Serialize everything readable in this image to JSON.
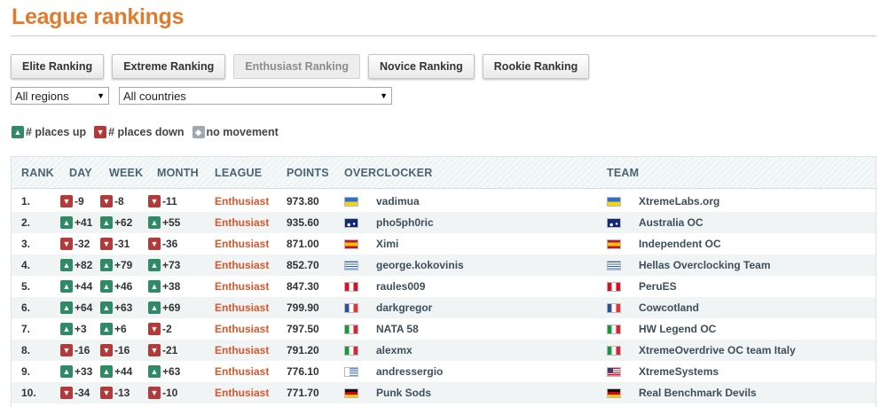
{
  "page": {
    "title": "League rankings"
  },
  "tabs": [
    {
      "label": "Elite Ranking",
      "active": false
    },
    {
      "label": "Extreme Ranking",
      "active": false
    },
    {
      "label": "Enthusiast Ranking",
      "active": true
    },
    {
      "label": "Novice Ranking",
      "active": false
    },
    {
      "label": "Rookie Ranking",
      "active": false
    }
  ],
  "filters": {
    "region": {
      "value": "All regions"
    },
    "country": {
      "value": "All countries"
    }
  },
  "legend": {
    "up": "# places up",
    "down": "# places down",
    "none": "no movement"
  },
  "columns": [
    "RANK",
    "DAY",
    "WEEK",
    "MONTH",
    "LEAGUE",
    "POINTS",
    "OVERCLOCKER",
    "TEAM"
  ],
  "colors": {
    "title": "#e07b2e",
    "up": "#2f8a65",
    "down": "#b23a3a",
    "none": "#9da8b1",
    "league": "#d9572b"
  },
  "rows": [
    {
      "rank": "1.",
      "day": "-9",
      "week": "-8",
      "month": "-11",
      "league": "Enthusiast",
      "points": "973.80",
      "overclocker": "vadimua",
      "oc_flag": "ukraine",
      "team": "XtremeLabs.org",
      "team_flag": "ukraine"
    },
    {
      "rank": "2.",
      "day": "+41",
      "week": "+62",
      "month": "+55",
      "league": "Enthusiast",
      "points": "935.60",
      "overclocker": "pho5ph0ric",
      "oc_flag": "australia",
      "team": "Australia OC",
      "team_flag": "australia"
    },
    {
      "rank": "3.",
      "day": "-32",
      "week": "-31",
      "month": "-36",
      "league": "Enthusiast",
      "points": "871.00",
      "overclocker": "Ximi",
      "oc_flag": "spain",
      "team": "Independent OC",
      "team_flag": "spain"
    },
    {
      "rank": "4.",
      "day": "+82",
      "week": "+79",
      "month": "+73",
      "league": "Enthusiast",
      "points": "852.70",
      "overclocker": "george.kokovinis",
      "oc_flag": "greece",
      "team": "Hellas Overclocking Team",
      "team_flag": "greece"
    },
    {
      "rank": "5.",
      "day": "+44",
      "week": "+46",
      "month": "+38",
      "league": "Enthusiast",
      "points": "847.30",
      "overclocker": "raules009",
      "oc_flag": "peru",
      "team": "PeruES",
      "team_flag": "peru"
    },
    {
      "rank": "6.",
      "day": "+64",
      "week": "+63",
      "month": "+69",
      "league": "Enthusiast",
      "points": "799.90",
      "overclocker": "darkgregor",
      "oc_flag": "france",
      "team": "Cowcotland",
      "team_flag": "france"
    },
    {
      "rank": "7.",
      "day": "+3",
      "week": "+6",
      "month": "-2",
      "league": "Enthusiast",
      "points": "797.50",
      "overclocker": "NATA 58",
      "oc_flag": "italy",
      "team": "HW Legend OC",
      "team_flag": "italy"
    },
    {
      "rank": "8.",
      "day": "-16",
      "week": "-16",
      "month": "-21",
      "league": "Enthusiast",
      "points": "791.20",
      "overclocker": "alexmx",
      "oc_flag": "italy",
      "team": "XtremeOverdrive OC team Italy",
      "team_flag": "italy"
    },
    {
      "rank": "9.",
      "day": "+33",
      "week": "+44",
      "month": "+63",
      "league": "Enthusiast",
      "points": "776.10",
      "overclocker": "andressergio",
      "oc_flag": "uruguay",
      "team": "XtremeSystems",
      "team_flag": "usa"
    },
    {
      "rank": "10.",
      "day": "-34",
      "week": "-13",
      "month": "-10",
      "league": "Enthusiast",
      "points": "771.70",
      "overclocker": "Punk Sods",
      "oc_flag": "germany",
      "team": "Real Benchmark Devils",
      "team_flag": "germany"
    }
  ]
}
